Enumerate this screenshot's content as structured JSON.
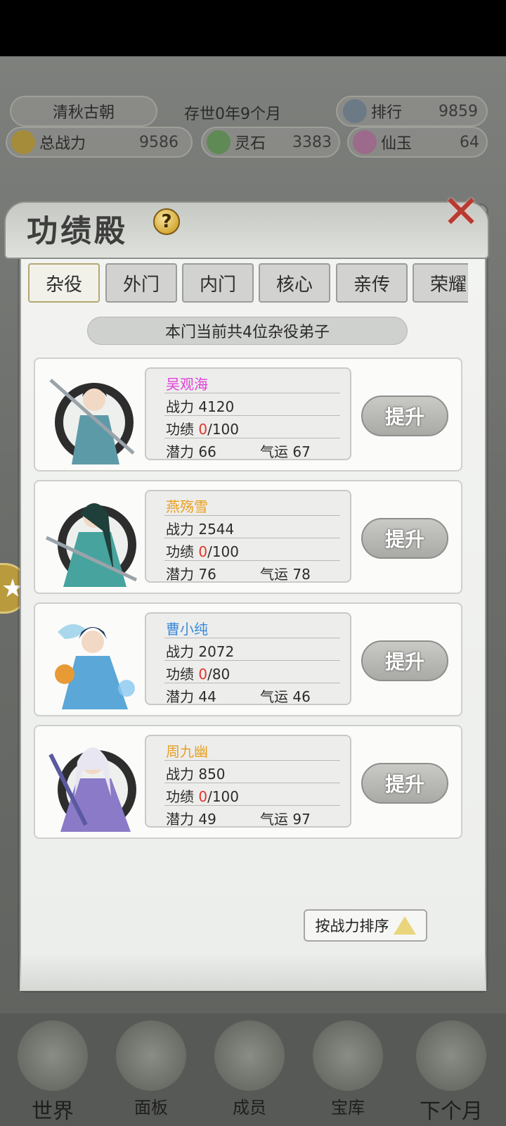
{
  "header": {
    "sect_name": "清秋古朝",
    "survival": "存世0年9个月",
    "rank_label": "排行",
    "rank_value": "9859",
    "power_label": "总战力",
    "power_value": "9586",
    "spirit_stone_label": "灵石",
    "spirit_stone_value": "3383",
    "jade_label": "仙玉",
    "jade_value": "64"
  },
  "panel": {
    "title": "功绩殿",
    "help": "?",
    "tabs": [
      "杂役",
      "外门",
      "内门",
      "核心",
      "亲传",
      "荣耀"
    ],
    "active_tab": "杂役",
    "banner": "本门当前共4位杂役弟子",
    "sort_label": "按战力排序"
  },
  "disciples": [
    {
      "name": "吴观海",
      "name_color": "#e040d8",
      "power_label": "战力",
      "power": "4120",
      "merit_label": "功绩",
      "merit_cur": "0",
      "merit_max": "/100",
      "potential_label": "潜力",
      "potential": "66",
      "luck_label": "气运",
      "luck": "67",
      "button": "提升",
      "robe": "#5d9aa8"
    },
    {
      "name": "燕殇雪",
      "name_color": "#e8a020",
      "power_label": "战力",
      "power": "2544",
      "merit_label": "功绩",
      "merit_cur": "0",
      "merit_max": "/100",
      "potential_label": "潜力",
      "potential": "76",
      "luck_label": "气运",
      "luck": "78",
      "button": "提升",
      "robe": "#47a39e"
    },
    {
      "name": "曹小纯",
      "name_color": "#3a8ad8",
      "power_label": "战力",
      "power": "2072",
      "merit_label": "功绩",
      "merit_cur": "0",
      "merit_max": "/80",
      "potential_label": "潜力",
      "potential": "44",
      "luck_label": "气运",
      "luck": "46",
      "button": "提升",
      "robe": "#5aa7d8"
    },
    {
      "name": "周九幽",
      "name_color": "#e8a020",
      "power_label": "战力",
      "power": "850",
      "merit_label": "功绩",
      "merit_cur": "0",
      "merit_max": "/100",
      "potential_label": "潜力",
      "potential": "49",
      "luck_label": "气运",
      "luck": "97",
      "button": "提升",
      "robe": "#8a7ac8"
    }
  ],
  "bottom_nav": [
    "世界",
    "面板",
    "成员",
    "宝库",
    "下个月"
  ],
  "colors": {
    "merit_red": "#e0362a",
    "accent_gold": "#d6aa3a"
  }
}
